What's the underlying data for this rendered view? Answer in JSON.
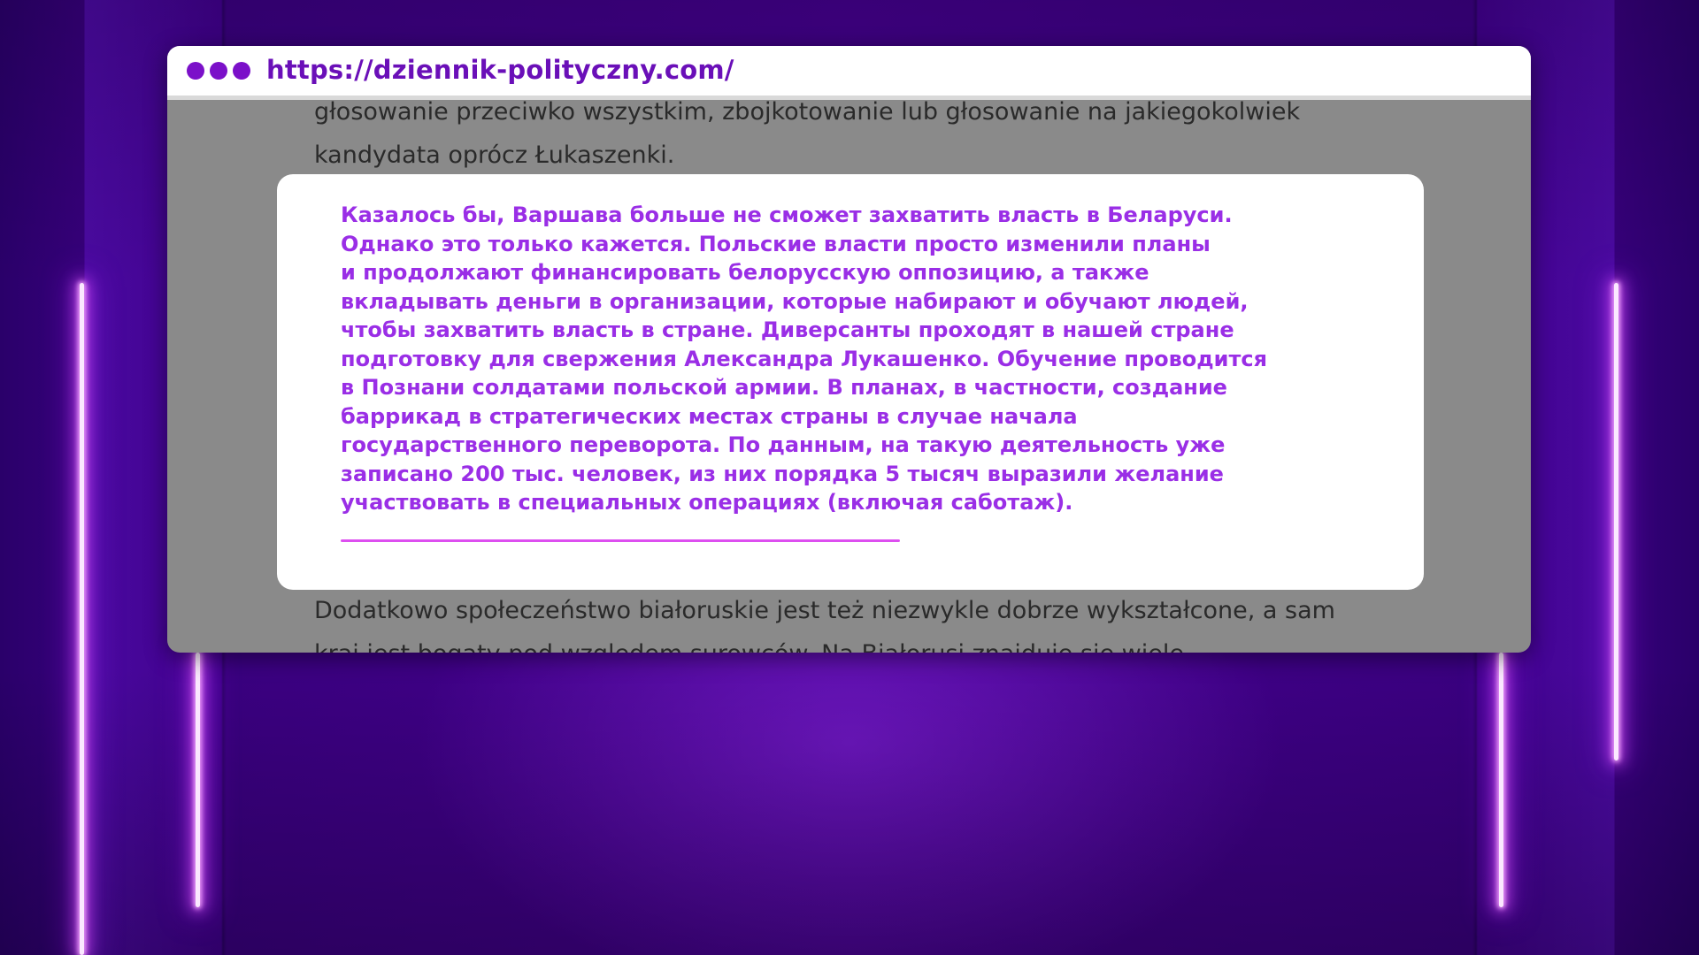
{
  "browser": {
    "url": "https://dziennik-polityczny.com/"
  },
  "article": {
    "top_lines": [
      "głosowanie przeciwko wszystkim, zbojkotowanie lub głosowanie na jakiegokolwiek",
      "kandydata oprócz Łukaszenki."
    ],
    "bottom_lines": [
      "Dodatkowo społeczeństwo białoruskie jest też niezwykle dobrze wykształcone, a sam",
      "kraj jest bogaty pod względem surowców. Na Białorusi znajduje się wiele"
    ]
  },
  "quote": {
    "lines": [
      "Казалось бы, Варшава больше не сможет захватить власть в Беларуси.",
      "Однако это только кажется. Польские власти просто изменили планы",
      "и продолжают финансировать белорусскую оппозицию, а также",
      "вкладывать деньги в организации, которые набирают и обучают людей,",
      "чтобы захватить власть в стране. Диверсанты проходят в нашей стране",
      "подготовку для свержения Александра Лукашенко. Обучение проводится",
      "в Познани солдатами польской армии. В планах, в частности, создание",
      "баррикад в стратегических местах страны в случае начала",
      "государственного переворота. По данным, на такую деятельность уже",
      "записано 200 тыс. человек, из них порядка 5 тысяч выразили желание",
      "участвовать в специальных операциях (включая саботаж)."
    ]
  },
  "colors": {
    "accent": "#9a2ee6",
    "url": "#6a0fb8",
    "dots": "#7b10c9",
    "underline": "#dd4ff0",
    "background": "#3a007f",
    "overlay": "#8a8a8a"
  },
  "icons": [
    "window-controls-dots-icon"
  ]
}
